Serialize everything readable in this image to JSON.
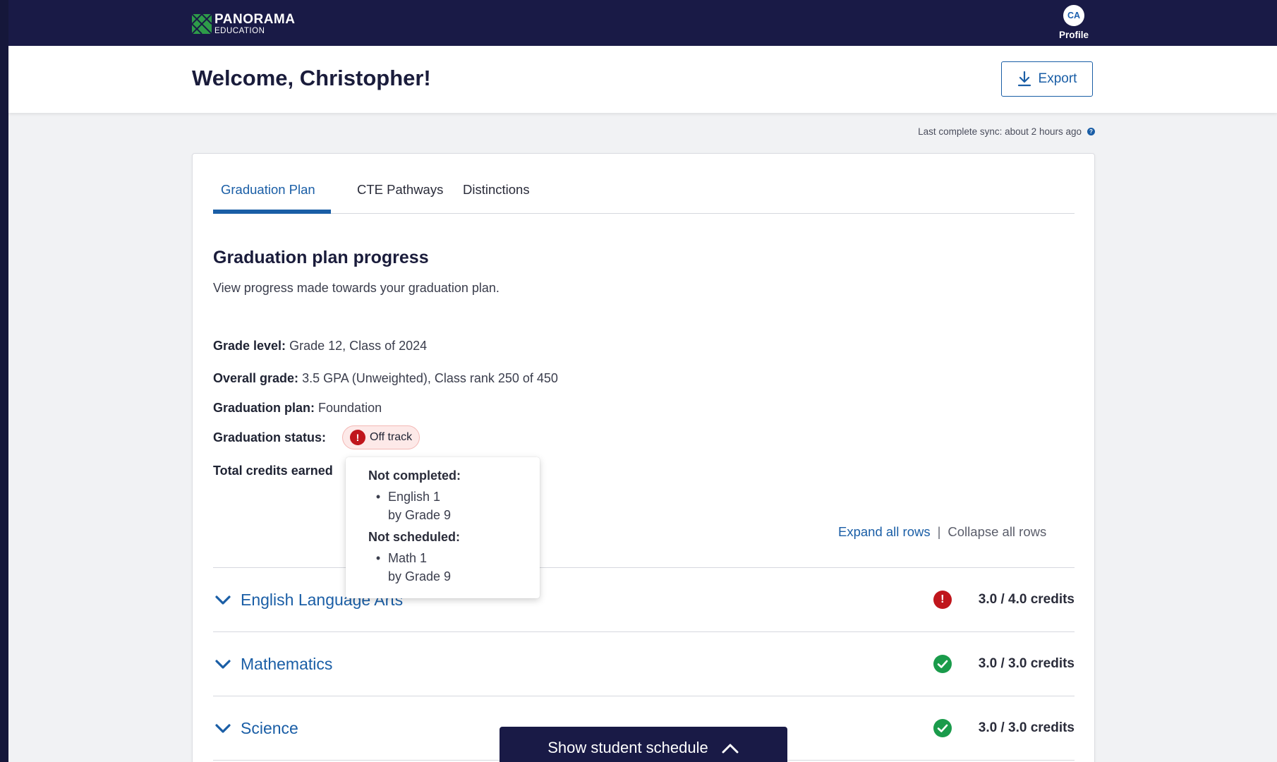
{
  "brand": {
    "name": "PANORAMA",
    "subtitle": "EDUCATION",
    "color": "#191a46",
    "accent": "#1a5ea6"
  },
  "profile": {
    "initials": "CA",
    "label": "Profile"
  },
  "header": {
    "welcome": "Welcome, Christopher!",
    "export_label": "Export"
  },
  "sync": {
    "text": "Last complete sync: about 2 hours ago",
    "help_icon": "?"
  },
  "tabs": [
    {
      "label": "Graduation Plan",
      "active": true
    },
    {
      "label": "CTE Pathways",
      "active": false
    },
    {
      "label": "Distinctions",
      "active": false
    }
  ],
  "progress": {
    "title": "Graduation plan progress",
    "description": "View progress made towards your graduation plan.",
    "grade_level_label": "Grade level:",
    "grade_level_value": "Grade 12, Class of 2024",
    "overall_grade_label": "Overall grade:",
    "overall_grade_value": "3.5 GPA (Unweighted), Class rank 250 of 450",
    "plan_label": "Graduation plan:",
    "plan_value": "Foundation",
    "status_label": "Graduation status:",
    "status_value": "Off track",
    "status_color": "#c0161c",
    "credits_label": "Total credits earned"
  },
  "popover": {
    "not_completed_heading": "Not completed:",
    "not_completed_item": "English 1",
    "not_completed_sub": "by Grade 9",
    "not_scheduled_heading": "Not scheduled:",
    "not_scheduled_item": "Math 1",
    "not_scheduled_sub": "by Grade 9",
    "bullet": "•"
  },
  "row_controls": {
    "expand": "Expand all rows",
    "separator": "|",
    "collapse": "Collapse all rows"
  },
  "subjects": [
    {
      "name": "English Language Arts",
      "status": "alert-icon",
      "credits": "3.0 / 4.0 credits"
    },
    {
      "name": "Mathematics",
      "status": "check-icon",
      "credits": "3.0 / 3.0 credits"
    },
    {
      "name": "Science",
      "status": "check-icon",
      "credits": "3.0 / 3.0 credits"
    }
  ],
  "schedule_button": {
    "label": "Show student schedule"
  }
}
